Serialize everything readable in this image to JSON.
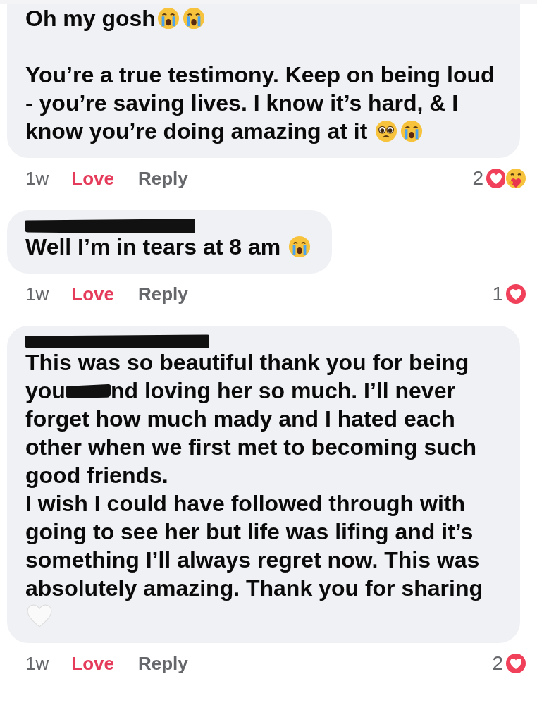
{
  "comments": [
    {
      "author_redacted": false,
      "cut_top": true,
      "paragraphs": [
        [
          {
            "kind": "text",
            "text": "Oh my gosh"
          },
          {
            "kind": "crying"
          },
          {
            "kind": "crying"
          },
          {
            "kind": "text",
            "text": "\n\nYou’re a true testimony. Keep on being loud - you’re saving lives. I know it’s hard, & I know you’re doing amazing at it "
          },
          {
            "kind": "pleading"
          },
          {
            "kind": "crying"
          }
        ]
      ],
      "time": "1w",
      "love": "Love",
      "reacted": true,
      "reply": "Reply",
      "count": "2",
      "reactions": [
        {
          "kind": "love"
        },
        {
          "kind": "care"
        }
      ]
    },
    {
      "author_redacted": true,
      "cut_top": false,
      "paragraphs": [
        [
          {
            "kind": "text",
            "text": "Well I’m in tears at 8 am "
          },
          {
            "kind": "crying"
          }
        ]
      ],
      "time": "1w",
      "love": "Love",
      "reacted": true,
      "reply": "Reply",
      "count": "1",
      "reactions": [
        {
          "kind": "love"
        }
      ]
    },
    {
      "author_redacted": true,
      "cut_top": false,
      "paragraphs": [
        [
          {
            "kind": "text",
            "text": "This was so beautiful thank you for being you"
          },
          {
            "kind": "redaction"
          },
          {
            "kind": "text",
            "text": "nd loving her so much. I’ll never forget how much mady and I hated each other when we first met to becoming such good friends."
          }
        ],
        [
          {
            "kind": "text",
            "text": "I wish I could have followed through with going to see her but life was lifing and it’s something I’ll always regret now. This was absolutely amazing. Thank you for sharing "
          },
          {
            "kind": "white_heart"
          }
        ]
      ],
      "time": "1w",
      "love": "Love",
      "reacted": true,
      "reply": "Reply",
      "count": "2",
      "reactions": [
        {
          "kind": "love"
        }
      ]
    }
  ]
}
